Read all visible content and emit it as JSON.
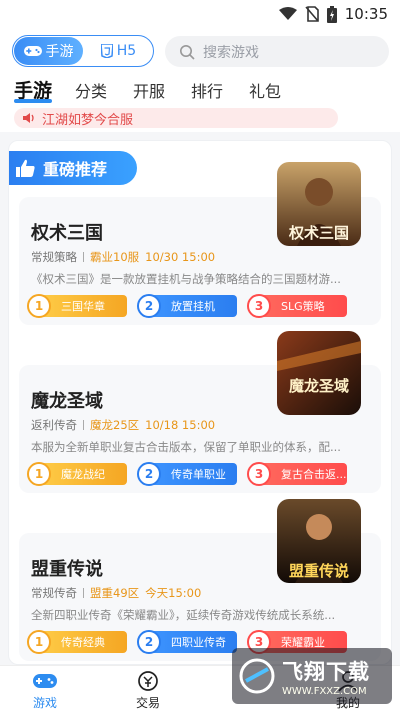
{
  "status": {
    "time": "10:35"
  },
  "switcher": {
    "mobile_label": "手游",
    "h5_label": "H5"
  },
  "search": {
    "placeholder": "搜索游戏"
  },
  "tabs": [
    {
      "label": "手游",
      "active": true
    },
    {
      "label": "分类"
    },
    {
      "label": "开服"
    },
    {
      "label": "排行"
    },
    {
      "label": "礼包"
    }
  ],
  "notice": {
    "text": "江湖如梦今合服"
  },
  "section": {
    "title": "重磅推荐"
  },
  "games": [
    {
      "name": "权术三国",
      "category": "常规策略",
      "server": "霸业10服",
      "open_time": "10/30 15:00",
      "desc": "《权术三国》是一款放置挂机与战争策略结合的三国题材游...",
      "tags": [
        {
          "num": "1",
          "label": "三国华章"
        },
        {
          "num": "2",
          "label": "放置挂机"
        },
        {
          "num": "3",
          "label": "SLG策略"
        }
      ],
      "cover_text": "权术三国"
    },
    {
      "name": "魔龙圣域",
      "category": "返利传奇",
      "server": "魔龙25区",
      "open_time": "10/18 15:00",
      "desc": "本服为全新单职业复古合击版本，保留了单职业的体系，配...",
      "tags": [
        {
          "num": "1",
          "label": "魔龙战纪"
        },
        {
          "num": "2",
          "label": "传奇单职业"
        },
        {
          "num": "3",
          "label": "复古合击返..."
        }
      ],
      "cover_text": "魔龙圣域"
    },
    {
      "name": "盟重传说",
      "category": "常规传奇",
      "server": "盟重49区",
      "open_time": "今天15:00",
      "desc": "全新四职业传奇《荣耀霸业》，延续传奇游戏传统成长系统...",
      "tags": [
        {
          "num": "1",
          "label": "传奇经典"
        },
        {
          "num": "2",
          "label": "四职业传奇"
        },
        {
          "num": "3",
          "label": "荣耀霸业"
        }
      ],
      "cover_text": "盟重传说"
    }
  ],
  "bottom_nav": [
    {
      "label": "游戏",
      "active": true
    },
    {
      "label": "交易"
    },
    {
      "label": "我的"
    }
  ],
  "watermark": {
    "title": "飞翔下载",
    "url": "WWW.FXXZ.COM"
  },
  "colors": {
    "accent": "#2d8cf0",
    "orange": "#e8961a",
    "red": "#e24a4a"
  }
}
